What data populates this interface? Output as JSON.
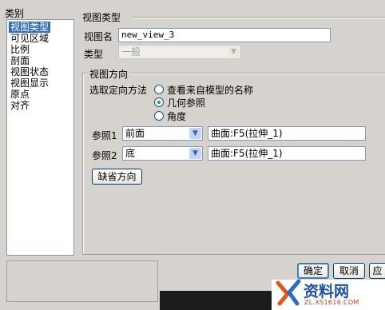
{
  "categories": {
    "title": "类别",
    "items": [
      "视图类型",
      "可见区域",
      "比例",
      "剖面",
      "视图状态",
      "视图显示",
      "原点",
      "对齐"
    ],
    "selected_index": 0
  },
  "view_type": {
    "group_label": "视图类型",
    "name_label": "视图名",
    "name_value": "new_view_3",
    "type_label": "类型",
    "type_value": "一般"
  },
  "orientation": {
    "group_label": "视图方向",
    "method_label": "选取定向方法",
    "options": [
      "查看来自模型的名称",
      "几何参照",
      "角度"
    ],
    "selected_option": 1,
    "ref1": {
      "label": "参照1",
      "combo_value": "前面",
      "field_value": "曲面:F5(拉伸_1)"
    },
    "ref2": {
      "label": "参照2",
      "combo_value": "底",
      "field_value": "曲面:F5(拉伸_1)"
    },
    "default_button": "缺省方向"
  },
  "buttons": {
    "ok": "确定",
    "cancel": "取消",
    "apply": "应"
  },
  "watermark": {
    "brand": "资料网",
    "url": "ZL.XS1616.COM"
  }
}
